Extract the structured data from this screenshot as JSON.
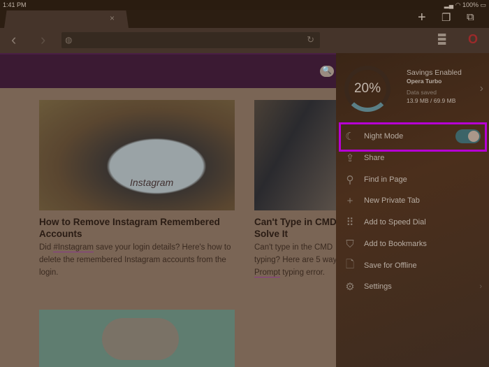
{
  "status": {
    "time": "1:41 PM",
    "battery": "100%"
  },
  "tab": {
    "close": "×"
  },
  "articles": [
    {
      "title": "How to Remove Instagram Remembered Accounts",
      "body_pre": "Did ",
      "link": "#Instagram",
      "body_post": " save your login details? Here's how to delete the remembered Instagram accounts from the login.",
      "image_text": "Instagram"
    },
    {
      "title": "Can't Type in CMD Solve It",
      "body_pre": "Can't type in the CMD typing? Here are 5 way ",
      "link": "Prompt",
      "body_post": " typing error."
    }
  ],
  "panel": {
    "percent": "20%",
    "savings_title": "Savings Enabled",
    "savings_sub": "Opera Turbo",
    "data_label": "Data saved",
    "data_value": "13.9 MB / 69.9 MB",
    "night_mode": {
      "label": "Night Mode",
      "enabled": true
    },
    "items": [
      {
        "label": "Share",
        "icon": "share-icon"
      },
      {
        "label": "Find in Page",
        "icon": "search-icon"
      },
      {
        "label": "New Private Tab",
        "icon": "plus-icon"
      },
      {
        "label": "Add to Speed Dial",
        "icon": "grid-icon"
      },
      {
        "label": "Add to Bookmarks",
        "icon": "bookmark-icon"
      },
      {
        "label": "Save for Offline",
        "icon": "document-icon"
      },
      {
        "label": "Settings",
        "icon": "gear-icon"
      }
    ]
  }
}
